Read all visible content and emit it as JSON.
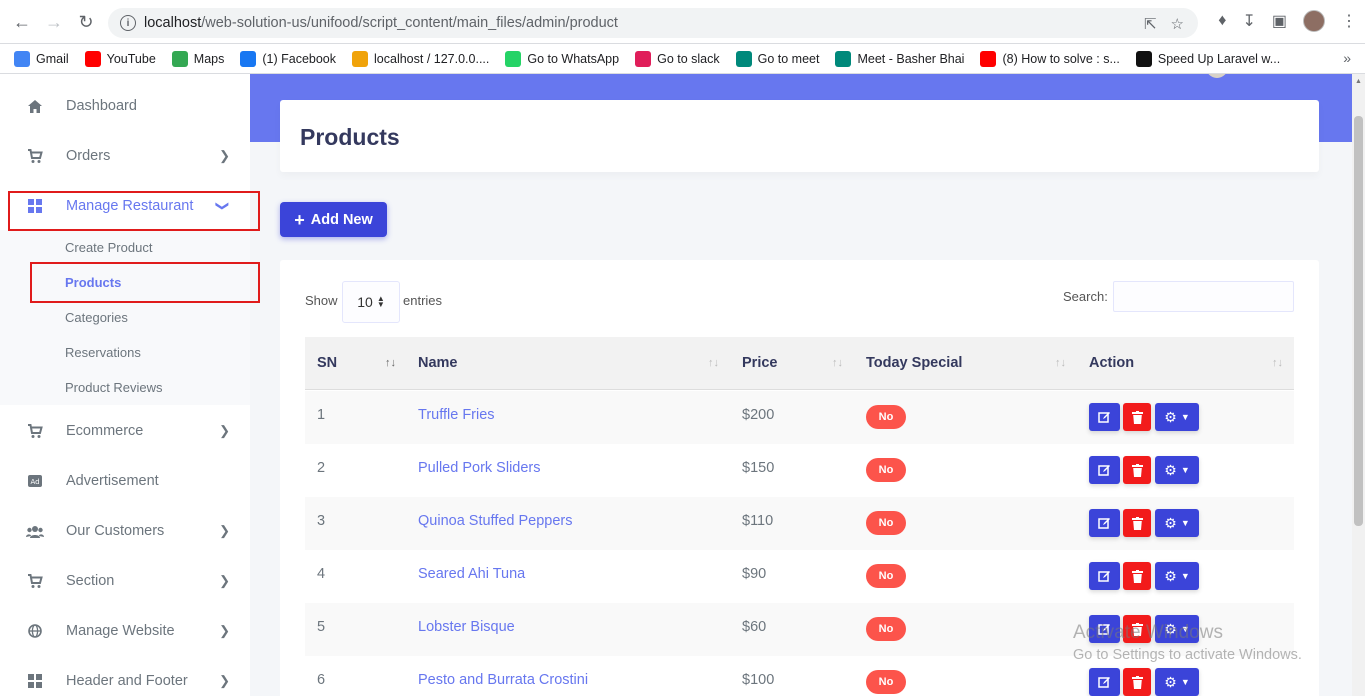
{
  "browser": {
    "url_host": "localhost",
    "url_path": "/web-solution-us/unifood/script_content/main_files/admin/product",
    "bookmarks": [
      {
        "label": "Gmail",
        "icon": "google-icon",
        "color": "#4285f4"
      },
      {
        "label": "YouTube",
        "icon": "youtube-icon",
        "color": "#ff0000"
      },
      {
        "label": "Maps",
        "icon": "maps-icon",
        "color": "#34a853"
      },
      {
        "label": "(1) Facebook",
        "icon": "facebook-icon",
        "color": "#1877f2"
      },
      {
        "label": "localhost / 127.0.0....",
        "icon": "phpmyadmin-icon",
        "color": "#f0a30a"
      },
      {
        "label": "Go to WhatsApp",
        "icon": "whatsapp-icon",
        "color": "#25d366"
      },
      {
        "label": "Go to slack",
        "icon": "slack-icon",
        "color": "#e01e5a"
      },
      {
        "label": "Go to meet",
        "icon": "meet-icon",
        "color": "#00897b"
      },
      {
        "label": "Meet - Basher Bhai",
        "icon": "meet-icon",
        "color": "#00897b"
      },
      {
        "label": "(8) How to solve : s...",
        "icon": "youtube-icon",
        "color": "#ff0000"
      },
      {
        "label": "Speed Up Laravel w...",
        "icon": "laravel-icon",
        "color": "#111111"
      }
    ]
  },
  "sidebar": {
    "items": [
      {
        "label": "Dashboard"
      },
      {
        "label": "Orders"
      },
      {
        "label": "Manage Restaurant"
      },
      {
        "label": "Ecommerce"
      },
      {
        "label": "Advertisement"
      },
      {
        "label": "Our Customers"
      },
      {
        "label": "Section"
      },
      {
        "label": "Manage Website"
      },
      {
        "label": "Header and Footer"
      }
    ],
    "submenu": [
      {
        "label": "Create Product"
      },
      {
        "label": "Products"
      },
      {
        "label": "Categories"
      },
      {
        "label": "Reservations"
      },
      {
        "label": "Product Reviews"
      }
    ]
  },
  "page": {
    "title": "Products",
    "add_button": "Add New"
  },
  "table": {
    "show_label": "Show",
    "entries_value": "10",
    "entries_label": "entries",
    "search_label": "Search:",
    "columns": [
      "SN",
      "Name",
      "Price",
      "Today Special",
      "Action"
    ],
    "rows": [
      {
        "sn": "1",
        "name": "Truffle Fries",
        "price": "$200",
        "special": "No"
      },
      {
        "sn": "2",
        "name": "Pulled Pork Sliders",
        "price": "$150",
        "special": "No"
      },
      {
        "sn": "3",
        "name": "Quinoa Stuffed Peppers",
        "price": "$110",
        "special": "No"
      },
      {
        "sn": "4",
        "name": "Seared Ahi Tuna",
        "price": "$90",
        "special": "No"
      },
      {
        "sn": "5",
        "name": "Lobster Bisque",
        "price": "$60",
        "special": "No"
      },
      {
        "sn": "6",
        "name": "Pesto and Burrata Crostini",
        "price": "$100",
        "special": "No"
      }
    ]
  },
  "watermark": {
    "line1": "Activate Windows",
    "line2": "Go to Settings to activate Windows."
  },
  "colors": {
    "primary": "#6777ef",
    "button": "#3b44d9",
    "danger": "#f21b1b",
    "badge": "#fc544b",
    "highlight": "#e01b1b"
  }
}
